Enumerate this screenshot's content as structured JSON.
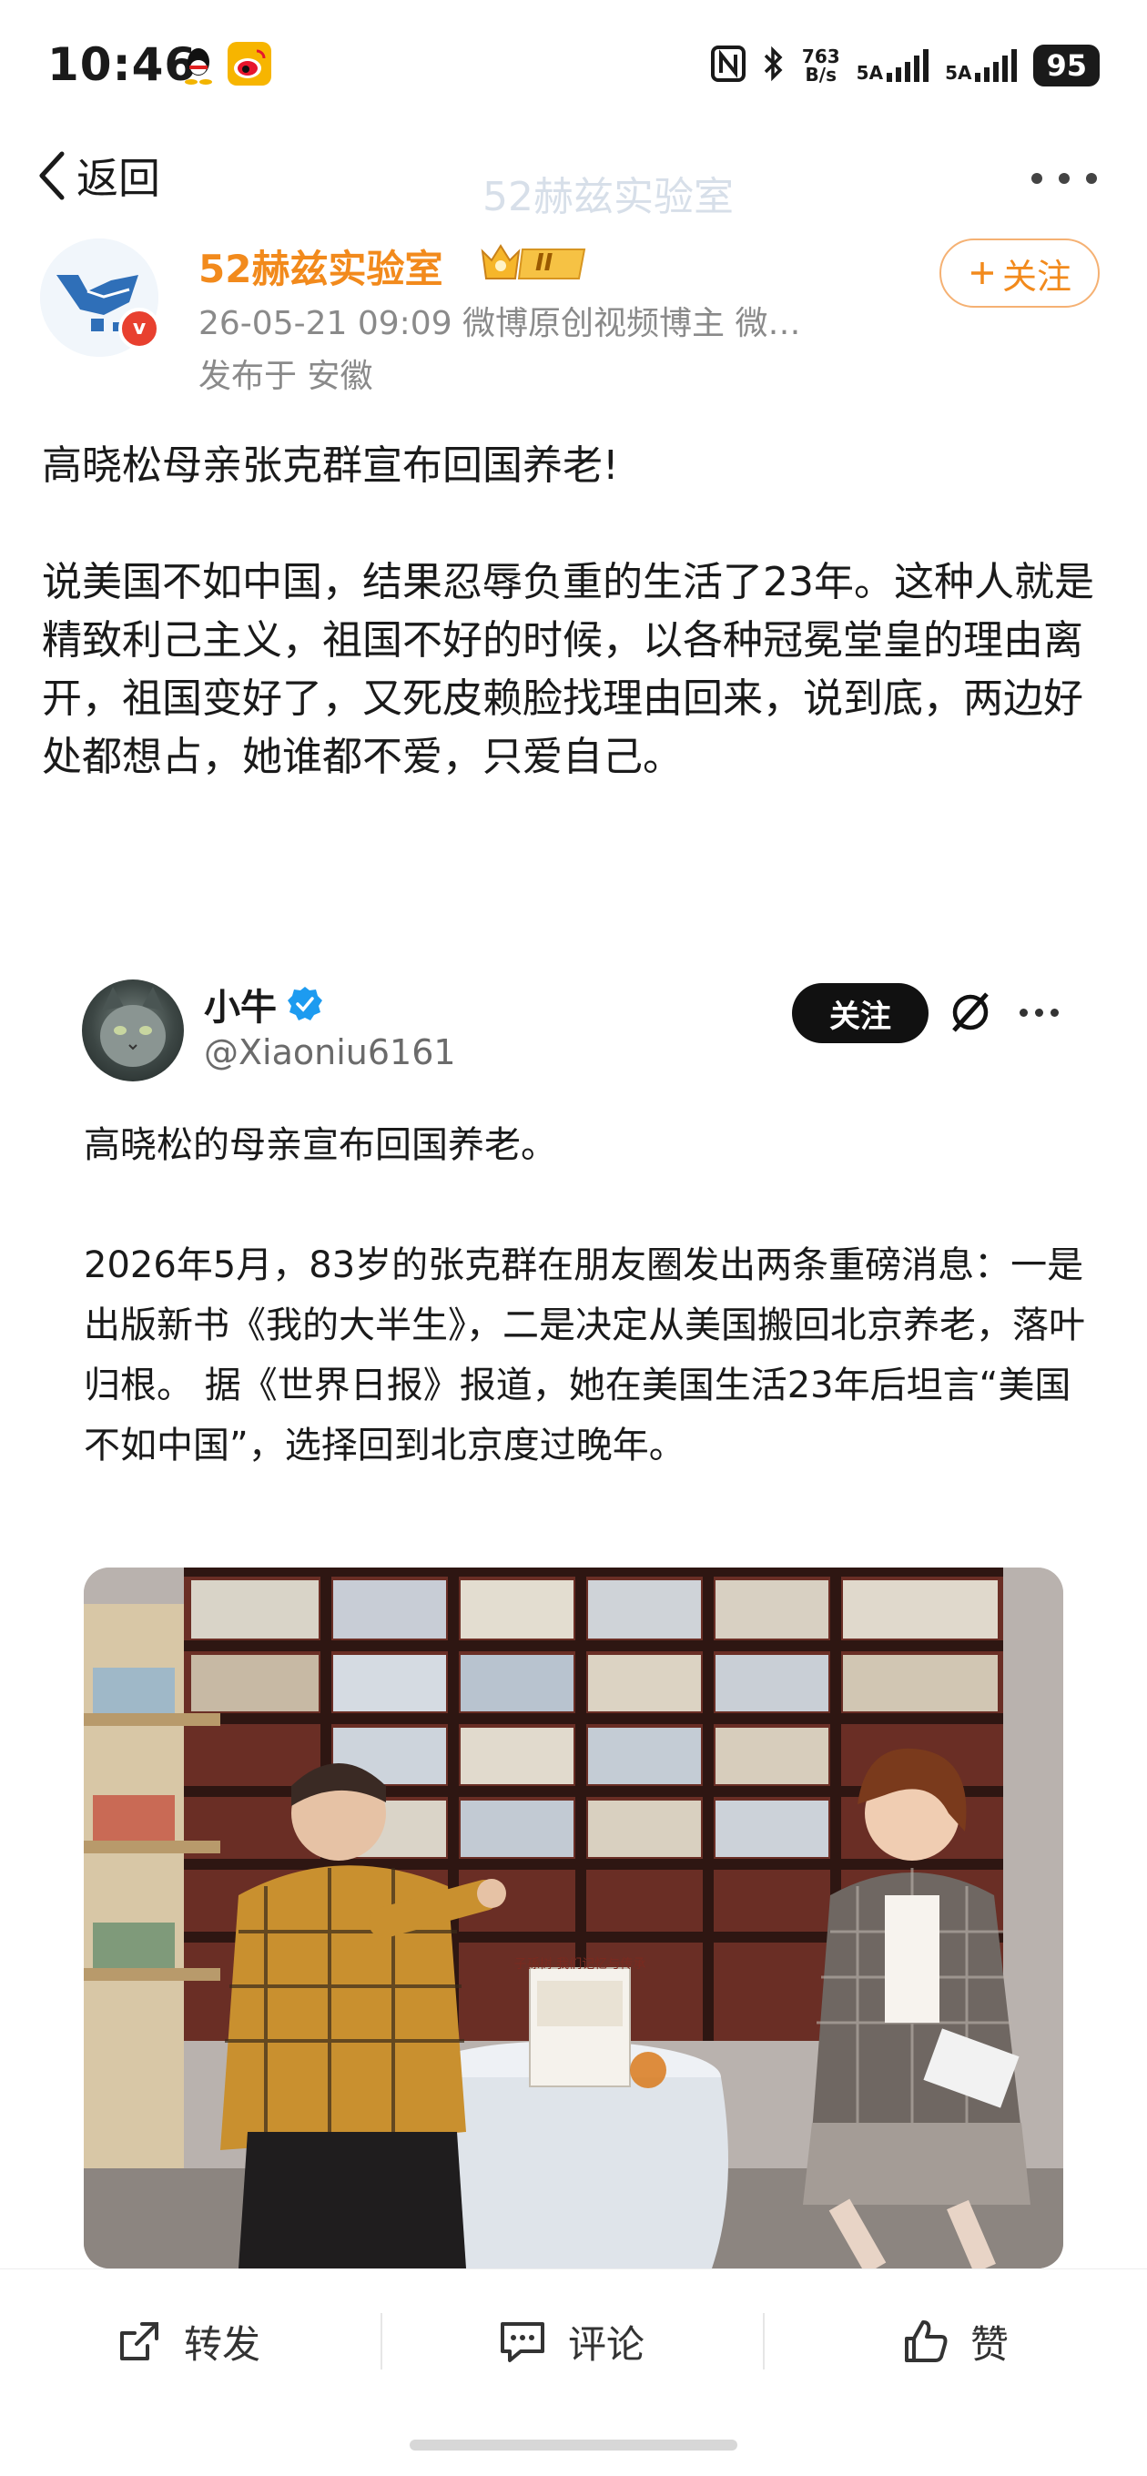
{
  "status_bar": {
    "time": "10:46",
    "net_speed_value": "763",
    "net_speed_unit": "B/s",
    "signal1_label": "5A",
    "signal2_label": "5A",
    "battery": "95"
  },
  "nav": {
    "back_label": "返回",
    "title": "52赫兹实验室"
  },
  "author": {
    "name": "52赫兹实验室",
    "level_badge": "II",
    "meta": "26-05-21 09:09  微博原创视频博主 微…",
    "location": "发布于 安徽",
    "follow_label": "关注",
    "verified_mark": "v"
  },
  "post": {
    "headline": "高晓松母亲张克群宣布回国养老!",
    "body": "说美国不如中国，结果忍辱负重的生活了23年。这种人就是精致利己主义，祖国不好的时候，以各种冠冕堂皇的理由离开，祖国变好了，又死皮赖脸找理由回来，说到底，两边好处都想占，她谁都不爱，只爱自己。"
  },
  "quoted": {
    "name": "小牛",
    "handle": "@Xiaoniu6161",
    "follow_label": "关注",
    "line1": "高晓松的母亲宣布回国养老。",
    "body": "2026年5月，83岁的张克群在朋友圈发出两条重磅消息：一是出版新书《我的大半生》，二是决定从美国搬回北京养老，落叶归根。 据《世界日报》报道，她在美国生活23年后坦言“美国不如中国”，选择回到北京度过晚年。",
    "photo_book_title": "子孫树 我们记忆与传承"
  },
  "actions": {
    "repost": "转发",
    "comment": "评论",
    "like": "赞"
  },
  "colors": {
    "accent_orange": "#f28a1c",
    "verified_blue": "#1d9bf0",
    "verified_red": "#e8402f"
  }
}
